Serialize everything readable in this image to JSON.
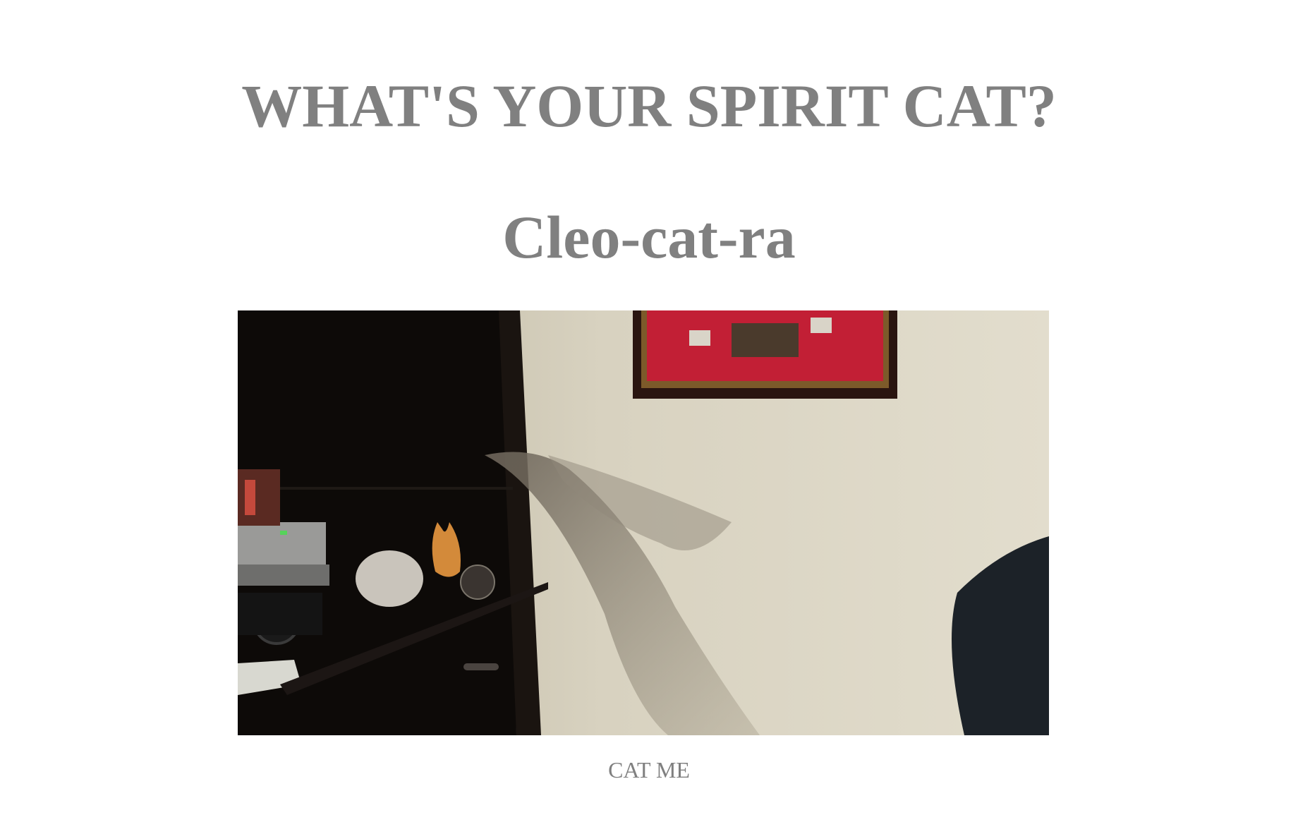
{
  "header": {
    "title": "WHAT'S YOUR SPIRIT CAT?"
  },
  "result": {
    "name": "Cleo-cat-ra"
  },
  "image": {
    "alt": "Cleo-cat-ra"
  },
  "actions": {
    "cat_me_label": "CAT ME"
  },
  "colors": {
    "heading_text": "#808080",
    "background": "#ffffff"
  }
}
